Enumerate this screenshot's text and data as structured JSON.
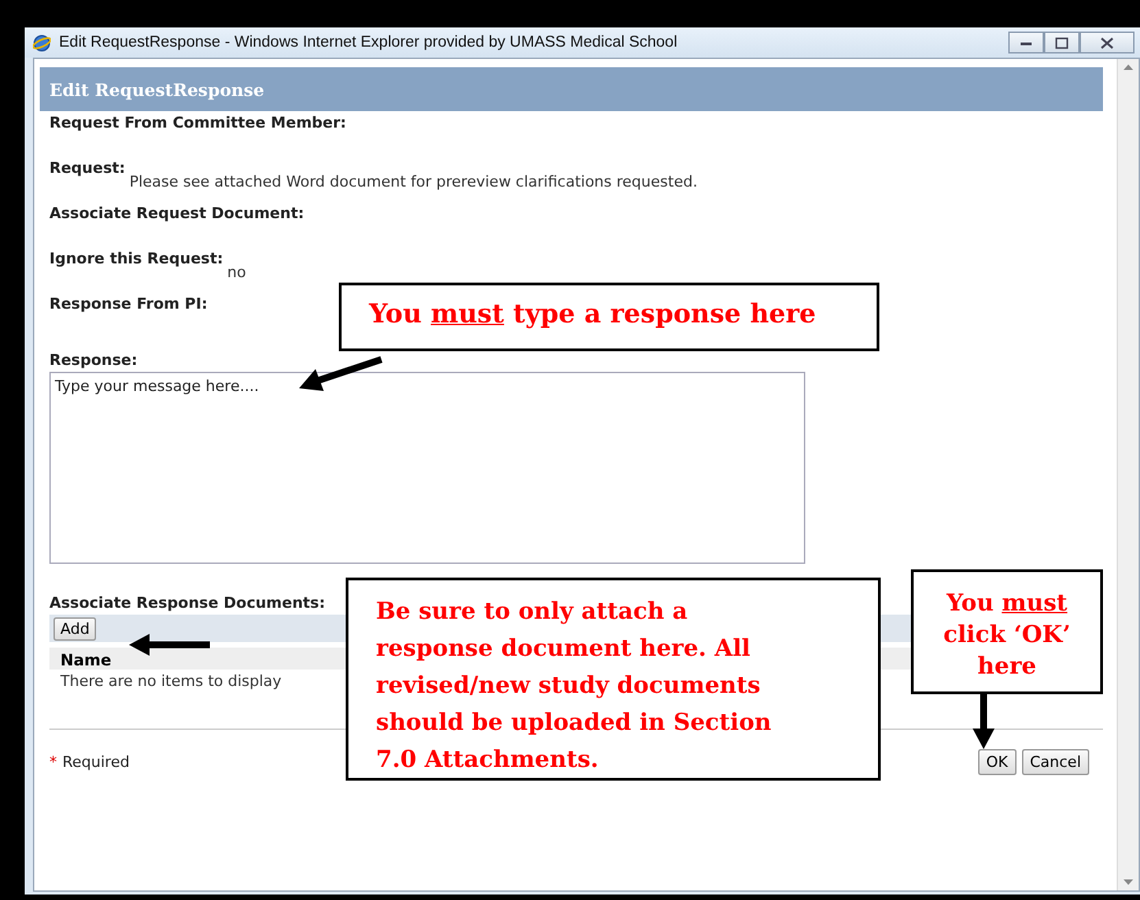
{
  "window": {
    "title": "Edit RequestResponse - Windows Internet Explorer provided by UMASS Medical School"
  },
  "dialog": {
    "title": "Edit RequestResponse",
    "fields": [
      {
        "label": "Request From Committee Member:"
      },
      {
        "label": "Request:",
        "value": "Please see attached Word document for prereview clarifications requested."
      },
      {
        "label": "Associate Request Document:"
      },
      {
        "label": "Ignore this Request:",
        "value": "no"
      },
      {
        "label": "Response From PI:"
      }
    ],
    "response": {
      "label": "Response:",
      "placeholder": "Type your message here...."
    },
    "documents": {
      "label": "Associate Response Documents:",
      "add_button": "Add",
      "columns": [
        "Name"
      ],
      "empty_message": "There are no items to display"
    },
    "required_note": {
      "mark": "*",
      "text": "Required"
    },
    "buttons": [
      "OK",
      "Cancel"
    ]
  },
  "callouts": [
    {
      "before": "You ",
      "underlined": "must",
      "after": " type a response here"
    },
    {
      "before": "Be sure to only attach a response document here. All revised/new study documents should be uploaded in Section 7.0 Attachments."
    },
    {
      "before": "You ",
      "underlined": "must",
      "after": " click ‘OK’ here"
    }
  ]
}
